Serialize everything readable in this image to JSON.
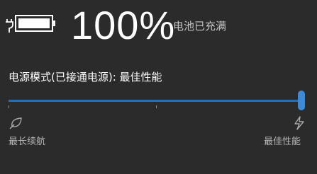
{
  "battery": {
    "percent_text": "100%",
    "status_text": "电池已充满",
    "level": 1.0,
    "icon": "battery-charging-full-icon"
  },
  "power_mode": {
    "label": "电源模式(已接通电源): 最佳性能",
    "slider_value": 1.0,
    "left_label": "最长续航",
    "right_label": "最佳性能",
    "left_icon": "leaf-icon",
    "right_icon": "lightning-icon"
  },
  "colors": {
    "background": "#2b2b2b",
    "accent": "#1f6fc0",
    "thumb": "#3a8bd9"
  }
}
